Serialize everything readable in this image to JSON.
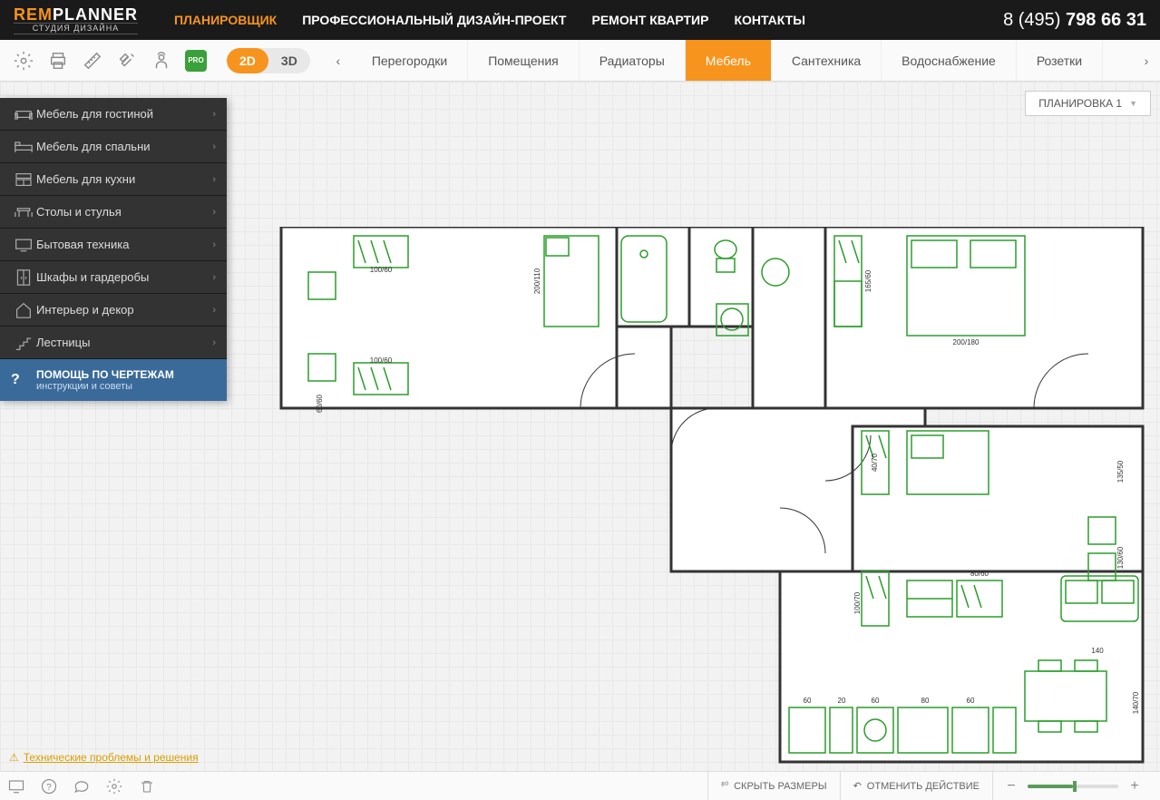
{
  "logo": {
    "prefix": "REM",
    "suffix": "PLANNER",
    "subtitle": "СТУДИЯ ДИЗАЙНА"
  },
  "nav": [
    {
      "label": "ПЛАНИРОВЩИК",
      "active": true
    },
    {
      "label": "ПРОФЕССИОНАЛЬНЫЙ ДИЗАЙН-ПРОЕКТ",
      "active": false
    },
    {
      "label": "РЕМОНТ КВАРТИР",
      "active": false
    },
    {
      "label": "КОНТАКТЫ",
      "active": false
    }
  ],
  "phone": {
    "prefix": "8 (495) ",
    "main": "798 66 31"
  },
  "view": {
    "d2": "2D",
    "d3": "3D"
  },
  "pro": "PRO",
  "tabs": [
    {
      "label": "Перегородки",
      "active": false
    },
    {
      "label": "Помещения",
      "active": false
    },
    {
      "label": "Радиаторы",
      "active": false
    },
    {
      "label": "Мебель",
      "active": true
    },
    {
      "label": "Сантехника",
      "active": false
    },
    {
      "label": "Водоснабжение",
      "active": false
    },
    {
      "label": "Розетки",
      "active": false
    }
  ],
  "layout_dropdown": "ПЛАНИРОВКА 1",
  "sidebar": {
    "items": [
      {
        "label": "Мебель для гостиной",
        "icon": "sofa-icon"
      },
      {
        "label": "Мебель для спальни",
        "icon": "bed-icon"
      },
      {
        "label": "Мебель для кухни",
        "icon": "kitchen-icon"
      },
      {
        "label": "Столы и стулья",
        "icon": "table-icon"
      },
      {
        "label": "Бытовая техника",
        "icon": "tv-icon"
      },
      {
        "label": "Шкафы и гардеробы",
        "icon": "wardrobe-icon"
      },
      {
        "label": "Интерьер и декор",
        "icon": "home-icon"
      },
      {
        "label": "Лестницы",
        "icon": "stairs-icon"
      }
    ],
    "help": {
      "title": "ПОМОЩЬ ПО ЧЕРТЕЖАМ",
      "subtitle": "инструкции и советы"
    }
  },
  "tech_link": "Технические проблемы и решения",
  "footer": {
    "hide_sizes": "СКРЫТЬ РАЗМЕРЫ",
    "undo": "ОТМЕНИТЬ ДЕЙСТВИЕ"
  },
  "plan_dims": {
    "d1": "100/60",
    "d2": "100/60",
    "d3": "200/110",
    "d4": "60/60",
    "d5": "200/180",
    "d6": "165/60",
    "d7": "140",
    "d8": "60",
    "d9": "80",
    "d10": "135/50",
    "d11": "130/60",
    "d12": "80/60",
    "d13": "40/70",
    "d14": "100/70",
    "d15": "60",
    "d16": "20",
    "d17": "60",
    "d18": "140/70"
  }
}
